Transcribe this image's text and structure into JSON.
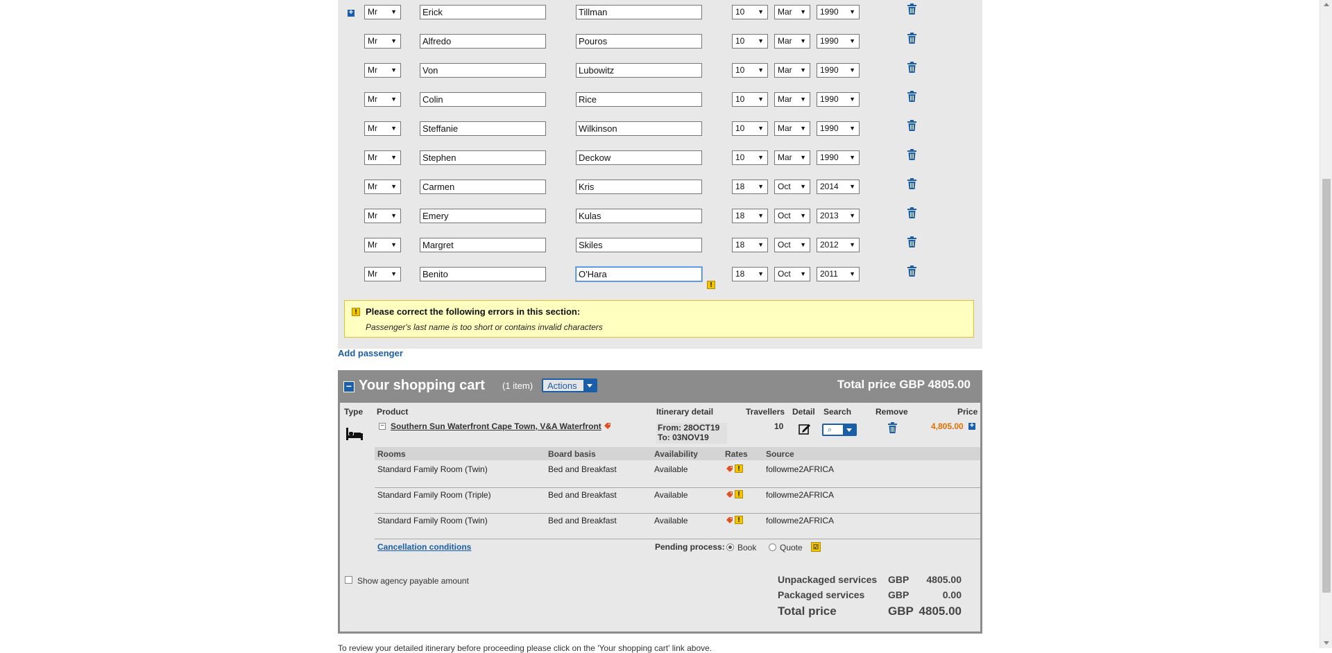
{
  "passengers": [
    {
      "title": "Mr",
      "first": "Erick",
      "last": "Tillman",
      "day": "10",
      "month": "Mar",
      "year": "1990"
    },
    {
      "title": "Mr",
      "first": "Alfredo",
      "last": "Pouros",
      "day": "10",
      "month": "Mar",
      "year": "1990"
    },
    {
      "title": "Mr",
      "first": "Von",
      "last": "Lubowitz",
      "day": "10",
      "month": "Mar",
      "year": "1990"
    },
    {
      "title": "Mr",
      "first": "Colin",
      "last": "Rice",
      "day": "10",
      "month": "Mar",
      "year": "1990"
    },
    {
      "title": "Mr",
      "first": "Steffanie",
      "last": "Wilkinson",
      "day": "10",
      "month": "Mar",
      "year": "1990"
    },
    {
      "title": "Mr",
      "first": "Stephen",
      "last": "Deckow",
      "day": "10",
      "month": "Mar",
      "year": "1990"
    },
    {
      "title": "Mr",
      "first": "Carmen",
      "last": "Kris",
      "day": "18",
      "month": "Oct",
      "year": "2014"
    },
    {
      "title": "Mr",
      "first": "Emery",
      "last": "Kulas",
      "day": "18",
      "month": "Oct",
      "year": "2013"
    },
    {
      "title": "Mr",
      "first": "Margret",
      "last": "Skiles",
      "day": "18",
      "month": "Oct",
      "year": "2012"
    },
    {
      "title": "Mr",
      "first": "Benito",
      "last": "O'Hara",
      "day": "18",
      "month": "Oct",
      "year": "2011"
    }
  ],
  "errors": {
    "title": "Please correct the following errors in this section:",
    "message": "Passenger's last name is too short or contains invalid characters"
  },
  "add_passenger": "Add passenger",
  "cart": {
    "title": "Your shopping cart",
    "items": "(1 item)",
    "actions": "Actions",
    "total_header": "Total price GBP 4805.00",
    "headers": {
      "type": "Type",
      "product": "Product",
      "itinerary": "Itinerary detail",
      "travellers": "Travellers",
      "detail": "Detail",
      "search": "Search",
      "remove": "Remove",
      "price": "Price"
    },
    "product": {
      "name": "Southern Sun Waterfront Cape Town, V&A Waterfront",
      "from": "From: 28OCT19",
      "to": "To: 03NOV19",
      "travellers": "10",
      "price": "4,805.00"
    },
    "rooms_headers": {
      "rooms": "Rooms",
      "board": "Board basis",
      "availability": "Availability",
      "rates": "Rates",
      "source": "Source"
    },
    "rooms": [
      {
        "room": "Standard Family Room (Twin)",
        "board": "Bed and Breakfast",
        "availability": "Available",
        "source": "followme2AFRICA"
      },
      {
        "room": "Standard Family Room (Triple)",
        "board": "Bed and Breakfast",
        "availability": "Available",
        "source": "followme2AFRICA"
      },
      {
        "room": "Standard Family Room (Twin)",
        "board": "Bed and Breakfast",
        "availability": "Available",
        "source": "followme2AFRICA"
      }
    ],
    "cancellation": "Cancellation conditions",
    "pending_label": "Pending process:",
    "book": "Book",
    "quote": "Quote",
    "show_agency": "Show agency payable amount",
    "summary": {
      "unpackaged_label": "Unpackaged services",
      "unpackaged_cur": "GBP",
      "unpackaged_val": "4805.00",
      "packaged_label": "Packaged services",
      "packaged_cur": "GBP",
      "packaged_val": "0.00",
      "total_label": "Total price",
      "total_cur": "GBP",
      "total_val": "4805.00"
    }
  },
  "footer_note": "To review your detailed itinerary before proceeding please click on the 'Your shopping cart' link above.",
  "colors": {
    "accent": "#1a5ea8",
    "price": "#e07000",
    "warning_bg": "#ffffc0",
    "panel": "#e8e8e8",
    "cart_header": "#8c8c8c"
  },
  "icons": [
    "expand-icon",
    "trash-icon",
    "warning-icon",
    "bed-icon",
    "tag-icon",
    "edit-icon",
    "magnifier-icon",
    "dropdown-arrow-icon",
    "collapse-icon",
    "pending-icon"
  ]
}
